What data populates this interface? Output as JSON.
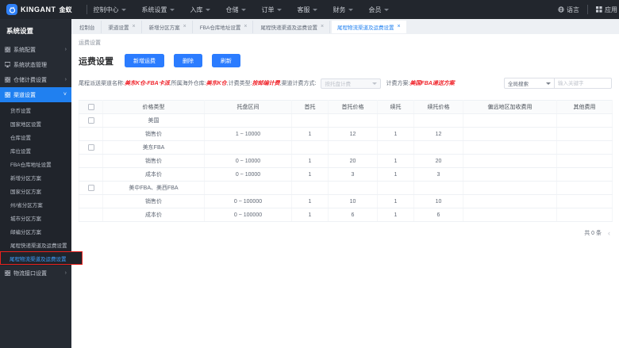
{
  "colors": {
    "accent": "#2080f0",
    "button": "#2b7cff",
    "danger": "#f0262d",
    "annotation": "#e8211d",
    "navbar_bg": "#22262d",
    "sidebar_bg": "#262b33"
  },
  "navbar": {
    "logo_text": "KINGANT",
    "logo_suffix": "金蚁",
    "menu": [
      "控制中心",
      "系统设置",
      "入库",
      "仓储",
      "订单",
      "客服",
      "财务",
      "会员"
    ],
    "right": {
      "language": "语言",
      "apps": "应用"
    }
  },
  "sidebar": {
    "title": "系统设置",
    "items": [
      {
        "label": "系统配置"
      },
      {
        "label": "系统状态管理"
      },
      {
        "label": "仓储计费设置"
      },
      {
        "label": "渠道设置"
      }
    ],
    "sub_items": [
      "货币设置",
      "国家地区设置",
      "仓库设置",
      "库位设置",
      "FBA仓库地址设置",
      "新增分区方案",
      "国家分区方案",
      "州/省分区方案",
      "城市分区方案",
      "邮编分区方案",
      "尾程快递渠道及运费设置",
      "尾程物流渠道及运费设置"
    ],
    "bottom_item": "物流接口设置"
  },
  "tabs": [
    {
      "label": "控制台"
    },
    {
      "label": "渠道设置"
    },
    {
      "label": "新增分区方案"
    },
    {
      "label": "FBA仓库地址设置"
    },
    {
      "label": "尾程快递渠道及运费设置"
    },
    {
      "label": "尾程物流渠道及运费设置"
    }
  ],
  "breadcrumb": "运费设置",
  "content": {
    "title": "运费设置",
    "buttons": [
      "新增运费",
      "删除",
      "刷新"
    ],
    "info": {
      "name_label": "尾程派送渠道名称:",
      "name_value": "美东K仓-FBA卡派",
      "warehouse_label": ",所属海外仓库:",
      "warehouse_value": "美东K仓",
      "billing_type_label": ",计费类型:",
      "billing_type_value": "按邮编计费",
      "billing_method_label": ",渠道计费方式:",
      "billing_method_select": "按托盘计费",
      "plan_label": "计费方案:",
      "plan_value": "美国FBA递送方案"
    },
    "search": {
      "scope": "全局搜索",
      "placeholder": "输入关键字"
    }
  },
  "table": {
    "headers": [
      "价格类型",
      "托盘区间",
      "首托",
      "首托价格",
      "续托",
      "续托价格",
      "偏远地区加收费用",
      "其他费用"
    ],
    "rows": [
      {
        "group": true,
        "cells": [
          "美国",
          "",
          "",
          "",
          "",
          "",
          "",
          ""
        ]
      },
      {
        "group": false,
        "cells": [
          "销售价",
          "1 ~ 10000",
          "1",
          "12",
          "1",
          "12",
          "",
          ""
        ]
      },
      {
        "group": true,
        "cells": [
          "美东FBA",
          "",
          "",
          "",
          "",
          "",
          "",
          ""
        ]
      },
      {
        "group": false,
        "cells": [
          "销售价",
          "0 ~ 10000",
          "1",
          "20",
          "1",
          "20",
          "",
          ""
        ]
      },
      {
        "group": false,
        "cells": [
          "成本价",
          "0 ~ 10000",
          "1",
          "3",
          "1",
          "3",
          "",
          ""
        ]
      },
      {
        "group": true,
        "cells": [
          "美中FBA、美西FBA",
          "",
          "",
          "",
          "",
          "",
          "",
          ""
        ]
      },
      {
        "group": false,
        "cells": [
          "销售价",
          "0 ~ 100000",
          "1",
          "10",
          "1",
          "10",
          "",
          ""
        ]
      },
      {
        "group": false,
        "cells": [
          "成本价",
          "0 ~ 100000",
          "1",
          "6",
          "1",
          "6",
          "",
          ""
        ]
      }
    ]
  },
  "footer": {
    "total": "共 0 条",
    "prev": "‹"
  }
}
